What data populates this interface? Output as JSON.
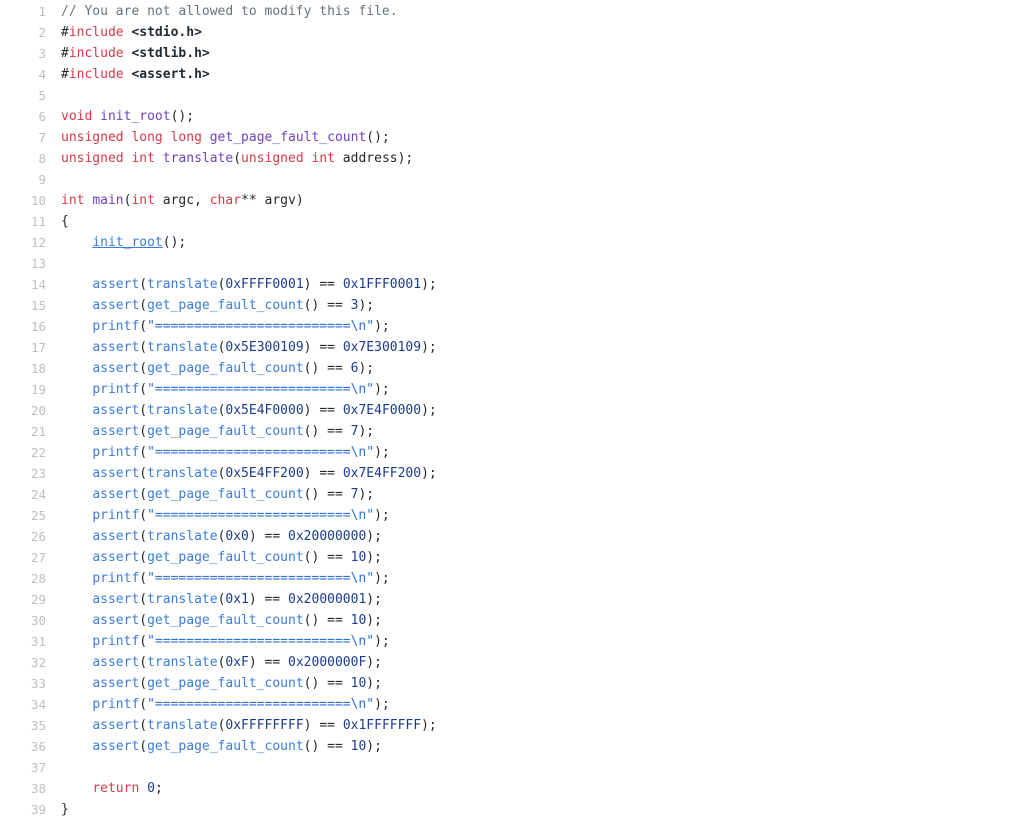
{
  "editor": {
    "language": "C",
    "first_line": 1,
    "last_line": 39,
    "gutter_color": "#bcc0c4",
    "background_color": "#ffffff",
    "theme_colors": {
      "comment": "#6a737d",
      "keyword": "#d73a49",
      "function_definition": "#6f42c1",
      "function_call": "#3b7dd8",
      "number": "#1b3c8c",
      "string": "#2f6fd0",
      "plain": "#24292e"
    }
  },
  "lines": [
    {
      "n": "1",
      "tokens": [
        {
          "t": "// You are not allowed to modify this file.",
          "c": "tok-comment"
        }
      ]
    },
    {
      "n": "2",
      "tokens": [
        {
          "t": "#",
          "c": "tok-hash"
        },
        {
          "t": "include",
          "c": "tok-preproc"
        },
        {
          "t": " ",
          "c": "tok-plain"
        },
        {
          "t": "<stdio.h>",
          "c": "tok-header"
        }
      ]
    },
    {
      "n": "3",
      "tokens": [
        {
          "t": "#",
          "c": "tok-hash"
        },
        {
          "t": "include",
          "c": "tok-preproc"
        },
        {
          "t": " ",
          "c": "tok-plain"
        },
        {
          "t": "<stdlib.h>",
          "c": "tok-header"
        }
      ]
    },
    {
      "n": "4",
      "tokens": [
        {
          "t": "#",
          "c": "tok-hash"
        },
        {
          "t": "include",
          "c": "tok-preproc"
        },
        {
          "t": " ",
          "c": "tok-plain"
        },
        {
          "t": "<assert.h>",
          "c": "tok-header"
        }
      ]
    },
    {
      "n": "5",
      "tokens": []
    },
    {
      "n": "6",
      "tokens": [
        {
          "t": "void",
          "c": "tok-keyword"
        },
        {
          "t": " ",
          "c": "tok-plain"
        },
        {
          "t": "init_root",
          "c": "tok-fndef"
        },
        {
          "t": "();",
          "c": "tok-punct"
        }
      ]
    },
    {
      "n": "7",
      "tokens": [
        {
          "t": "unsigned",
          "c": "tok-keyword"
        },
        {
          "t": " ",
          "c": "tok-plain"
        },
        {
          "t": "long",
          "c": "tok-keyword"
        },
        {
          "t": " ",
          "c": "tok-plain"
        },
        {
          "t": "long",
          "c": "tok-keyword"
        },
        {
          "t": " ",
          "c": "tok-plain"
        },
        {
          "t": "get_page_fault_count",
          "c": "tok-fndef"
        },
        {
          "t": "();",
          "c": "tok-punct"
        }
      ]
    },
    {
      "n": "8",
      "tokens": [
        {
          "t": "unsigned",
          "c": "tok-keyword"
        },
        {
          "t": " ",
          "c": "tok-plain"
        },
        {
          "t": "int",
          "c": "tok-keyword"
        },
        {
          "t": " ",
          "c": "tok-plain"
        },
        {
          "t": "translate",
          "c": "tok-fndef"
        },
        {
          "t": "(",
          "c": "tok-punct"
        },
        {
          "t": "unsigned",
          "c": "tok-keyword"
        },
        {
          "t": " ",
          "c": "tok-plain"
        },
        {
          "t": "int",
          "c": "tok-keyword"
        },
        {
          "t": " address);",
          "c": "tok-plain"
        }
      ]
    },
    {
      "n": "9",
      "tokens": []
    },
    {
      "n": "10",
      "tokens": [
        {
          "t": "int",
          "c": "tok-keyword"
        },
        {
          "t": " ",
          "c": "tok-plain"
        },
        {
          "t": "main",
          "c": "tok-fndef"
        },
        {
          "t": "(",
          "c": "tok-punct"
        },
        {
          "t": "int",
          "c": "tok-keyword"
        },
        {
          "t": " argc, ",
          "c": "tok-plain"
        },
        {
          "t": "char",
          "c": "tok-keyword"
        },
        {
          "t": "**",
          "c": "tok-op"
        },
        {
          "t": " argv)",
          "c": "tok-plain"
        }
      ]
    },
    {
      "n": "11",
      "tokens": [
        {
          "t": "{",
          "c": "tok-punct"
        }
      ]
    },
    {
      "n": "12",
      "tokens": [
        {
          "t": "    ",
          "c": "tok-plain"
        },
        {
          "t": "init_root",
          "c": "tok-fnlink"
        },
        {
          "t": "();",
          "c": "tok-punct"
        }
      ]
    },
    {
      "n": "13",
      "tokens": []
    },
    {
      "n": "14",
      "tokens": [
        {
          "t": "    ",
          "c": "tok-plain"
        },
        {
          "t": "assert",
          "c": "tok-fncall"
        },
        {
          "t": "(",
          "c": "tok-punct"
        },
        {
          "t": "translate",
          "c": "tok-fncall"
        },
        {
          "t": "(",
          "c": "tok-punct"
        },
        {
          "t": "0xFFFF0001",
          "c": "tok-number"
        },
        {
          "t": ") == ",
          "c": "tok-punct"
        },
        {
          "t": "0x1FFF0001",
          "c": "tok-number"
        },
        {
          "t": ");",
          "c": "tok-punct"
        }
      ]
    },
    {
      "n": "15",
      "tokens": [
        {
          "t": "    ",
          "c": "tok-plain"
        },
        {
          "t": "assert",
          "c": "tok-fncall"
        },
        {
          "t": "(",
          "c": "tok-punct"
        },
        {
          "t": "get_page_fault_count",
          "c": "tok-fncall"
        },
        {
          "t": "() == ",
          "c": "tok-punct"
        },
        {
          "t": "3",
          "c": "tok-number"
        },
        {
          "t": ");",
          "c": "tok-punct"
        }
      ]
    },
    {
      "n": "16",
      "tokens": [
        {
          "t": "    ",
          "c": "tok-plain"
        },
        {
          "t": "printf",
          "c": "tok-fncall"
        },
        {
          "t": "(",
          "c": "tok-punct"
        },
        {
          "t": "\"=========================\\n\"",
          "c": "tok-string"
        },
        {
          "t": ");",
          "c": "tok-punct"
        }
      ]
    },
    {
      "n": "17",
      "tokens": [
        {
          "t": "    ",
          "c": "tok-plain"
        },
        {
          "t": "assert",
          "c": "tok-fncall"
        },
        {
          "t": "(",
          "c": "tok-punct"
        },
        {
          "t": "translate",
          "c": "tok-fncall"
        },
        {
          "t": "(",
          "c": "tok-punct"
        },
        {
          "t": "0x5E300109",
          "c": "tok-number"
        },
        {
          "t": ") == ",
          "c": "tok-punct"
        },
        {
          "t": "0x7E300109",
          "c": "tok-number"
        },
        {
          "t": ");",
          "c": "tok-punct"
        }
      ]
    },
    {
      "n": "18",
      "tokens": [
        {
          "t": "    ",
          "c": "tok-plain"
        },
        {
          "t": "assert",
          "c": "tok-fncall"
        },
        {
          "t": "(",
          "c": "tok-punct"
        },
        {
          "t": "get_page_fault_count",
          "c": "tok-fncall"
        },
        {
          "t": "() == ",
          "c": "tok-punct"
        },
        {
          "t": "6",
          "c": "tok-number"
        },
        {
          "t": ");",
          "c": "tok-punct"
        }
      ]
    },
    {
      "n": "19",
      "tokens": [
        {
          "t": "    ",
          "c": "tok-plain"
        },
        {
          "t": "printf",
          "c": "tok-fncall"
        },
        {
          "t": "(",
          "c": "tok-punct"
        },
        {
          "t": "\"=========================\\n\"",
          "c": "tok-string"
        },
        {
          "t": ");",
          "c": "tok-punct"
        }
      ]
    },
    {
      "n": "20",
      "tokens": [
        {
          "t": "    ",
          "c": "tok-plain"
        },
        {
          "t": "assert",
          "c": "tok-fncall"
        },
        {
          "t": "(",
          "c": "tok-punct"
        },
        {
          "t": "translate",
          "c": "tok-fncall"
        },
        {
          "t": "(",
          "c": "tok-punct"
        },
        {
          "t": "0x5E4F0000",
          "c": "tok-number"
        },
        {
          "t": ") == ",
          "c": "tok-punct"
        },
        {
          "t": "0x7E4F0000",
          "c": "tok-number"
        },
        {
          "t": ");",
          "c": "tok-punct"
        }
      ]
    },
    {
      "n": "21",
      "tokens": [
        {
          "t": "    ",
          "c": "tok-plain"
        },
        {
          "t": "assert",
          "c": "tok-fncall"
        },
        {
          "t": "(",
          "c": "tok-punct"
        },
        {
          "t": "get_page_fault_count",
          "c": "tok-fncall"
        },
        {
          "t": "() == ",
          "c": "tok-punct"
        },
        {
          "t": "7",
          "c": "tok-number"
        },
        {
          "t": ");",
          "c": "tok-punct"
        }
      ]
    },
    {
      "n": "22",
      "tokens": [
        {
          "t": "    ",
          "c": "tok-plain"
        },
        {
          "t": "printf",
          "c": "tok-fncall"
        },
        {
          "t": "(",
          "c": "tok-punct"
        },
        {
          "t": "\"=========================\\n\"",
          "c": "tok-string"
        },
        {
          "t": ");",
          "c": "tok-punct"
        }
      ]
    },
    {
      "n": "23",
      "tokens": [
        {
          "t": "    ",
          "c": "tok-plain"
        },
        {
          "t": "assert",
          "c": "tok-fncall"
        },
        {
          "t": "(",
          "c": "tok-punct"
        },
        {
          "t": "translate",
          "c": "tok-fncall"
        },
        {
          "t": "(",
          "c": "tok-punct"
        },
        {
          "t": "0x5E4FF200",
          "c": "tok-number"
        },
        {
          "t": ") == ",
          "c": "tok-punct"
        },
        {
          "t": "0x7E4FF200",
          "c": "tok-number"
        },
        {
          "t": ");",
          "c": "tok-punct"
        }
      ]
    },
    {
      "n": "24",
      "tokens": [
        {
          "t": "    ",
          "c": "tok-plain"
        },
        {
          "t": "assert",
          "c": "tok-fncall"
        },
        {
          "t": "(",
          "c": "tok-punct"
        },
        {
          "t": "get_page_fault_count",
          "c": "tok-fncall"
        },
        {
          "t": "() == ",
          "c": "tok-punct"
        },
        {
          "t": "7",
          "c": "tok-number"
        },
        {
          "t": ");",
          "c": "tok-punct"
        }
      ]
    },
    {
      "n": "25",
      "tokens": [
        {
          "t": "    ",
          "c": "tok-plain"
        },
        {
          "t": "printf",
          "c": "tok-fncall"
        },
        {
          "t": "(",
          "c": "tok-punct"
        },
        {
          "t": "\"=========================\\n\"",
          "c": "tok-string"
        },
        {
          "t": ");",
          "c": "tok-punct"
        }
      ]
    },
    {
      "n": "26",
      "tokens": [
        {
          "t": "    ",
          "c": "tok-plain"
        },
        {
          "t": "assert",
          "c": "tok-fncall"
        },
        {
          "t": "(",
          "c": "tok-punct"
        },
        {
          "t": "translate",
          "c": "tok-fncall"
        },
        {
          "t": "(",
          "c": "tok-punct"
        },
        {
          "t": "0x0",
          "c": "tok-number"
        },
        {
          "t": ") == ",
          "c": "tok-punct"
        },
        {
          "t": "0x20000000",
          "c": "tok-number"
        },
        {
          "t": ");",
          "c": "tok-punct"
        }
      ]
    },
    {
      "n": "27",
      "tokens": [
        {
          "t": "    ",
          "c": "tok-plain"
        },
        {
          "t": "assert",
          "c": "tok-fncall"
        },
        {
          "t": "(",
          "c": "tok-punct"
        },
        {
          "t": "get_page_fault_count",
          "c": "tok-fncall"
        },
        {
          "t": "() == ",
          "c": "tok-punct"
        },
        {
          "t": "10",
          "c": "tok-number"
        },
        {
          "t": ");",
          "c": "tok-punct"
        }
      ]
    },
    {
      "n": "28",
      "tokens": [
        {
          "t": "    ",
          "c": "tok-plain"
        },
        {
          "t": "printf",
          "c": "tok-fncall"
        },
        {
          "t": "(",
          "c": "tok-punct"
        },
        {
          "t": "\"=========================\\n\"",
          "c": "tok-string"
        },
        {
          "t": ");",
          "c": "tok-punct"
        }
      ]
    },
    {
      "n": "29",
      "tokens": [
        {
          "t": "    ",
          "c": "tok-plain"
        },
        {
          "t": "assert",
          "c": "tok-fncall"
        },
        {
          "t": "(",
          "c": "tok-punct"
        },
        {
          "t": "translate",
          "c": "tok-fncall"
        },
        {
          "t": "(",
          "c": "tok-punct"
        },
        {
          "t": "0x1",
          "c": "tok-number"
        },
        {
          "t": ") == ",
          "c": "tok-punct"
        },
        {
          "t": "0x20000001",
          "c": "tok-number"
        },
        {
          "t": ");",
          "c": "tok-punct"
        }
      ]
    },
    {
      "n": "30",
      "tokens": [
        {
          "t": "    ",
          "c": "tok-plain"
        },
        {
          "t": "assert",
          "c": "tok-fncall"
        },
        {
          "t": "(",
          "c": "tok-punct"
        },
        {
          "t": "get_page_fault_count",
          "c": "tok-fncall"
        },
        {
          "t": "() == ",
          "c": "tok-punct"
        },
        {
          "t": "10",
          "c": "tok-number"
        },
        {
          "t": ");",
          "c": "tok-punct"
        }
      ]
    },
    {
      "n": "31",
      "tokens": [
        {
          "t": "    ",
          "c": "tok-plain"
        },
        {
          "t": "printf",
          "c": "tok-fncall"
        },
        {
          "t": "(",
          "c": "tok-punct"
        },
        {
          "t": "\"=========================\\n\"",
          "c": "tok-string"
        },
        {
          "t": ");",
          "c": "tok-punct"
        }
      ]
    },
    {
      "n": "32",
      "tokens": [
        {
          "t": "    ",
          "c": "tok-plain"
        },
        {
          "t": "assert",
          "c": "tok-fncall"
        },
        {
          "t": "(",
          "c": "tok-punct"
        },
        {
          "t": "translate",
          "c": "tok-fncall"
        },
        {
          "t": "(",
          "c": "tok-punct"
        },
        {
          "t": "0xF",
          "c": "tok-number"
        },
        {
          "t": ") == ",
          "c": "tok-punct"
        },
        {
          "t": "0x2000000F",
          "c": "tok-number"
        },
        {
          "t": ");",
          "c": "tok-punct"
        }
      ]
    },
    {
      "n": "33",
      "tokens": [
        {
          "t": "    ",
          "c": "tok-plain"
        },
        {
          "t": "assert",
          "c": "tok-fncall"
        },
        {
          "t": "(",
          "c": "tok-punct"
        },
        {
          "t": "get_page_fault_count",
          "c": "tok-fncall"
        },
        {
          "t": "() == ",
          "c": "tok-punct"
        },
        {
          "t": "10",
          "c": "tok-number"
        },
        {
          "t": ");",
          "c": "tok-punct"
        }
      ]
    },
    {
      "n": "34",
      "tokens": [
        {
          "t": "    ",
          "c": "tok-plain"
        },
        {
          "t": "printf",
          "c": "tok-fncall"
        },
        {
          "t": "(",
          "c": "tok-punct"
        },
        {
          "t": "\"=========================\\n\"",
          "c": "tok-string"
        },
        {
          "t": ");",
          "c": "tok-punct"
        }
      ]
    },
    {
      "n": "35",
      "tokens": [
        {
          "t": "    ",
          "c": "tok-plain"
        },
        {
          "t": "assert",
          "c": "tok-fncall"
        },
        {
          "t": "(",
          "c": "tok-punct"
        },
        {
          "t": "translate",
          "c": "tok-fncall"
        },
        {
          "t": "(",
          "c": "tok-punct"
        },
        {
          "t": "0xFFFFFFFF",
          "c": "tok-number"
        },
        {
          "t": ") == ",
          "c": "tok-punct"
        },
        {
          "t": "0x1FFFFFFF",
          "c": "tok-number"
        },
        {
          "t": ");",
          "c": "tok-punct"
        }
      ]
    },
    {
      "n": "36",
      "tokens": [
        {
          "t": "    ",
          "c": "tok-plain"
        },
        {
          "t": "assert",
          "c": "tok-fncall"
        },
        {
          "t": "(",
          "c": "tok-punct"
        },
        {
          "t": "get_page_fault_count",
          "c": "tok-fncall"
        },
        {
          "t": "() == ",
          "c": "tok-punct"
        },
        {
          "t": "10",
          "c": "tok-number"
        },
        {
          "t": ");",
          "c": "tok-punct"
        }
      ]
    },
    {
      "n": "37",
      "tokens": []
    },
    {
      "n": "38",
      "tokens": [
        {
          "t": "    ",
          "c": "tok-plain"
        },
        {
          "t": "return",
          "c": "tok-keyword"
        },
        {
          "t": " ",
          "c": "tok-plain"
        },
        {
          "t": "0",
          "c": "tok-number"
        },
        {
          "t": ";",
          "c": "tok-punct"
        }
      ]
    },
    {
      "n": "39",
      "tokens": [
        {
          "t": "}",
          "c": "tok-punct"
        }
      ]
    }
  ]
}
